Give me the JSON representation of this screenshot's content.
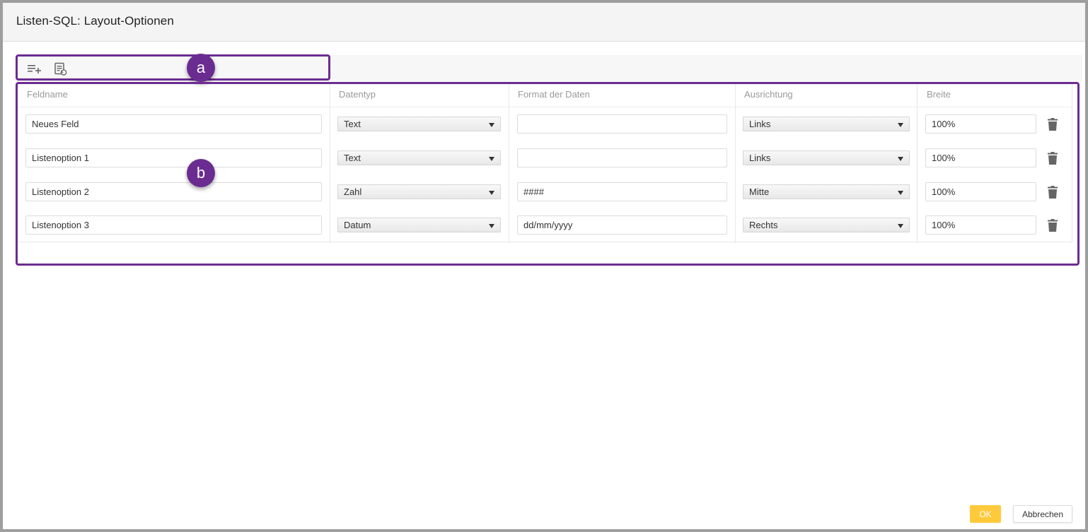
{
  "dialog": {
    "title": "Listen-SQL: Layout-Optionen",
    "ok_label": "OK",
    "cancel_label": "Abbrechen",
    "accent_color": "#ffc93c"
  },
  "toolbar": {
    "buttons": [
      {
        "icon": "add-row-icon"
      },
      {
        "icon": "reset-list-icon"
      }
    ]
  },
  "table": {
    "headers": [
      "Feldname",
      "Datentyp",
      "Format der Daten",
      "Ausrichtung",
      "Breite"
    ],
    "rows": [
      {
        "name": "Neues Feld",
        "type": "Text",
        "format": "",
        "align": "Links",
        "width": "100%"
      },
      {
        "name": "Listenoption 1",
        "type": "Text",
        "format": "",
        "align": "Links",
        "width": "100%"
      },
      {
        "name": "Listenoption 2",
        "type": "Zahl",
        "format": "####",
        "align": "Mitte",
        "width": "100%"
      },
      {
        "name": "Listenoption 3",
        "type": "Datum",
        "format": "dd/mm/yyyy",
        "align": "Rechts",
        "width": "100%"
      }
    ]
  },
  "annotations": {
    "a": "a",
    "b": "b",
    "color": "#6b2c91"
  }
}
